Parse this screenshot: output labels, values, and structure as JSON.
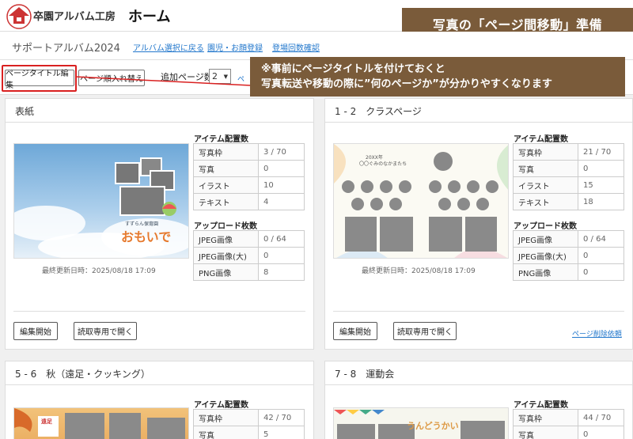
{
  "header": {
    "logo_text": "卒園アルバム工房",
    "page_title": "ホーム",
    "banner": "写真の「ページ間移動」準備"
  },
  "subnav": {
    "album_name": "サポートアルバム2024",
    "links": [
      "アルバム選択に戻る",
      "園児・お顔登録",
      "登場回数確認"
    ]
  },
  "toolbar": {
    "page_title_edit": "ページタイトル編集",
    "page_reorder": "ページ順入れ替え",
    "add_pages_label": "追加ページ数",
    "add_pages_value": "2",
    "add_link": "ペ"
  },
  "callout": {
    "line1": "※事前にページタイトルを付けておくと",
    "line2": "写真転送や移動の際に”何のページか”が分かりやすくなります"
  },
  "labels": {
    "items_title": "アイテム配置数",
    "uploads_title": "アップロード枚数",
    "edit_start": "編集開始",
    "open_readonly": "読取専用で開く",
    "delete_request": "ページ削除依頼"
  },
  "cards": [
    {
      "title": "表紙",
      "updated": "最終更新日時：2025/08/18 17:09",
      "items": [
        [
          "写真枠",
          "3 / 70"
        ],
        [
          "写真",
          "0"
        ],
        [
          "イラスト",
          "10"
        ],
        [
          "テキスト",
          "4"
        ]
      ],
      "uploads": [
        [
          "JPEG画像",
          "0 / 64"
        ],
        [
          "JPEG画像(大)",
          "0"
        ],
        [
          "PNG画像",
          "8"
        ]
      ],
      "thumb_text": "おもいで",
      "thumb_small": "すずらん保育園"
    },
    {
      "title": "1 - 2　クラスページ",
      "updated": "最終更新日時：2025/08/18 17:09",
      "items": [
        [
          "写真枠",
          "21 / 70"
        ],
        [
          "写真",
          "0"
        ],
        [
          "イラスト",
          "15"
        ],
        [
          "テキスト",
          "18"
        ]
      ],
      "uploads": [
        [
          "JPEG画像",
          "0 / 64"
        ],
        [
          "JPEG画像(大)",
          "0"
        ],
        [
          "PNG画像",
          "0"
        ]
      ],
      "thumb_text": "20XX年",
      "thumb_small": "〇〇ぐみのなかまたち"
    },
    {
      "title": "5 - 6　秋（遠足・クッキング）",
      "items": [
        [
          "写真枠",
          "42 / 70"
        ],
        [
          "写真",
          "5"
        ]
      ],
      "thumb_text": "遠足"
    },
    {
      "title": "7 - 8　運動会",
      "items": [
        [
          "写真枠",
          "44 / 70"
        ],
        [
          "写真",
          "0"
        ]
      ],
      "thumb_text": "うんどうかい"
    }
  ],
  "colors": {
    "banner_bg": "#7a5b3a",
    "highlight": "#d92020",
    "link": "#2277cc"
  }
}
